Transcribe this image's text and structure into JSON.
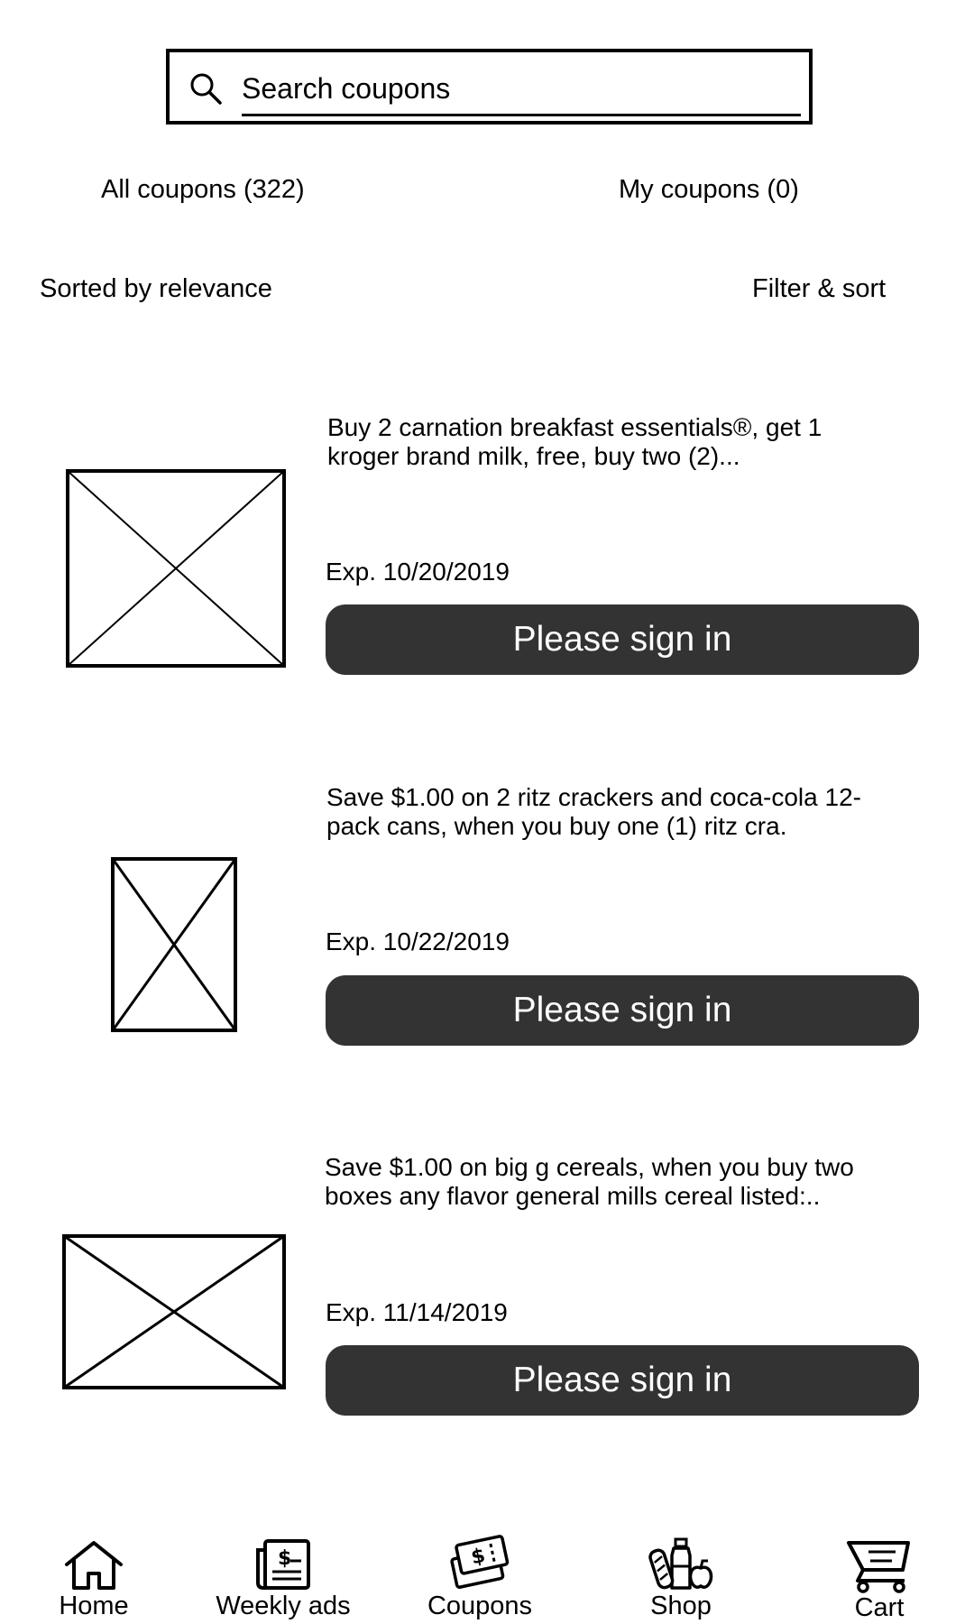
{
  "search": {
    "placeholder": "Search coupons"
  },
  "tabs": [
    {
      "label": "All coupons (322)"
    },
    {
      "label": "My coupons (0)"
    }
  ],
  "sort": {
    "label": "Sorted by relevance",
    "filter_label": "Filter & sort"
  },
  "coupons": [
    {
      "description": "Buy 2 carnation breakfast essentials®, get 1 kroger brand milk, free, buy two (2)...",
      "expiry": "Exp. 10/20/2019",
      "button_label": "Please sign in"
    },
    {
      "description": "Save $1.00 on 2 ritz crackers and coca-cola 12-pack cans, when you buy one (1) ritz cra.",
      "expiry": "Exp. 10/22/2019",
      "button_label": "Please sign in"
    },
    {
      "description": "Save $1.00 on big g cereals, when you buy two boxes any flavor general mills cereal listed:..",
      "expiry": "Exp. 11/14/2019",
      "button_label": "Please sign in"
    }
  ],
  "nav": [
    {
      "label": "Home",
      "icon": "home-icon"
    },
    {
      "label": "Weekly ads",
      "icon": "newspaper-icon"
    },
    {
      "label": "Coupons",
      "icon": "coupon-tickets-icon"
    },
    {
      "label": "Shop",
      "icon": "groceries-icon"
    },
    {
      "label": "Cart",
      "icon": "cart-icon"
    }
  ]
}
